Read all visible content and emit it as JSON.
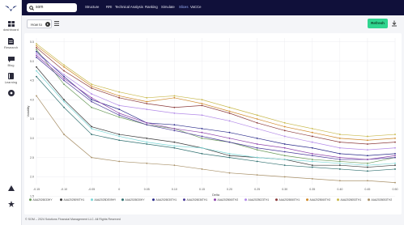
{
  "app": {
    "logo": "eagle-logo",
    "search": {
      "value": "som",
      "icon": "search-icon"
    },
    "nav": [
      {
        "label": "Structure",
        "active": false
      },
      {
        "label": "RRI",
        "active": false
      },
      {
        "label": "Technical Analysis",
        "active": false
      },
      {
        "label": "Ranking",
        "active": false
      },
      {
        "label": "Simulate",
        "active": false
      },
      {
        "label": "Slices",
        "active": true
      },
      {
        "label": "VaCCe",
        "active": false
      }
    ],
    "sidebar": [
      {
        "label": "dashboard",
        "icon": "dashboard-icon"
      },
      {
        "label": "Research",
        "icon": "document-icon"
      },
      {
        "label": "Blog",
        "icon": "chat-icon"
      },
      {
        "label": "Learning",
        "icon": "book-icon"
      },
      {
        "label": "",
        "icon": "chat-bubble-icon"
      },
      {
        "label": "",
        "icon": "alert-icon"
      },
      {
        "label": "",
        "icon": "star-icon"
      }
    ],
    "toolbar": {
      "how_to_label": "How to",
      "refresh_label": "Refresh"
    },
    "footer": "© SOM – 2024 Solutions Financial Management LLC. All Rights Reserved",
    "accent": "#2fd58f",
    "topbar_color": "#10103a"
  },
  "chart_data": {
    "type": "line",
    "xlabel": "Delta",
    "ylabel": "Volatility",
    "x": [
      -0.15,
      -0.1,
      -0.05,
      0,
      0.05,
      0.1,
      0.15,
      0.2,
      0.25,
      0.3,
      0.35,
      0.4,
      0.45,
      0.5
    ],
    "xticks": [
      "-0.15",
      "-0.10",
      "-0.05",
      "0",
      "0.05",
      "0.10",
      "0.15",
      "0.20",
      "0.25",
      "0.30",
      "0.35",
      "0.40",
      "0.45",
      "0.50"
    ],
    "ylim": [
      1.8,
      5.6
    ],
    "yticks": [
      "5.5",
      "5.0",
      "4.5",
      "4.0",
      "3.5",
      "3.0",
      "2.5",
      "2.0",
      "1.5"
    ],
    "grid": true,
    "legend_position": "bottom",
    "series": [
      {
        "name": "AAA2026033HY",
        "color": "#6a9a5a",
        "values": [
          5.3,
          4.4,
          3.8,
          3.55,
          3.35,
          3.25,
          3.0,
          2.9,
          2.7,
          2.55,
          2.45,
          2.4,
          2.35,
          2.5
        ]
      },
      {
        "name": "AAA2025090TH1",
        "color": "#3a3a3a",
        "values": [
          4.85,
          4.0,
          3.3,
          3.1,
          3.0,
          2.9,
          2.75,
          2.55,
          2.5,
          2.45,
          2.3,
          2.3,
          2.25,
          2.3
        ]
      },
      {
        "name": "AAA2025DE09HY",
        "color": "#7ad6d6",
        "values": [
          4.75,
          3.95,
          3.25,
          3.05,
          2.9,
          2.8,
          2.75,
          2.6,
          2.5,
          2.45,
          2.4,
          2.35,
          2.3,
          2.35
        ]
      },
      {
        "name": "AAA2026030HY",
        "color": "#2f6f6f",
        "values": [
          4.6,
          3.8,
          3.1,
          2.95,
          2.85,
          2.75,
          2.6,
          2.5,
          2.4,
          2.3,
          2.25,
          2.2,
          2.15,
          2.2
        ]
      },
      {
        "name": "AAA2026030TH1",
        "color": "#2a2a8a",
        "values": [
          5.25,
          4.6,
          4.0,
          3.75,
          3.4,
          3.35,
          3.25,
          3.15,
          3.0,
          2.85,
          2.75,
          2.6,
          2.55,
          2.6
        ]
      },
      {
        "name": "AAA2026036TH1",
        "color": "#4b3a9a",
        "values": [
          5.1,
          4.5,
          3.95,
          3.6,
          3.35,
          3.2,
          3.05,
          2.9,
          2.75,
          2.65,
          2.55,
          2.45,
          2.45,
          2.5
        ]
      },
      {
        "name": "AAA2025060TH2",
        "color": "#8e44ad",
        "values": [
          5.15,
          4.55,
          4.05,
          3.65,
          3.4,
          3.25,
          3.15,
          3.0,
          2.85,
          2.75,
          2.6,
          2.5,
          2.45,
          2.55
        ]
      },
      {
        "name": "AAA2025023TH1",
        "color": "#b38ae8",
        "values": [
          5.2,
          4.65,
          4.15,
          3.85,
          3.75,
          3.65,
          3.6,
          3.45,
          3.25,
          3.05,
          2.9,
          2.75,
          2.7,
          2.75
        ]
      },
      {
        "name": "AAA2026060TH1",
        "color": "#8b3a3a",
        "values": [
          5.35,
          4.75,
          4.3,
          4.05,
          3.9,
          3.8,
          3.85,
          3.65,
          3.4,
          3.2,
          3.05,
          2.9,
          2.85,
          2.9
        ]
      },
      {
        "name": "AAA2025060TH2",
        "color": "#d08a2a",
        "values": [
          5.4,
          4.85,
          4.35,
          4.1,
          3.95,
          4.05,
          3.9,
          3.7,
          3.5,
          3.3,
          3.15,
          3.0,
          2.95,
          3.0
        ]
      },
      {
        "name": "AAA2026053TH1",
        "color": "#c8b84a",
        "values": [
          5.45,
          4.9,
          4.4,
          4.2,
          4.05,
          4.1,
          4.0,
          3.8,
          3.6,
          3.4,
          3.25,
          3.1,
          3.05,
          3.1
        ]
      },
      {
        "name": "AAA2026053TH2",
        "color": "#a89068",
        "values": [
          4.1,
          3.1,
          2.5,
          2.4,
          2.35,
          2.3,
          2.2,
          2.1,
          2.05,
          2.0,
          1.95,
          1.9,
          1.9,
          1.85
        ]
      }
    ]
  }
}
